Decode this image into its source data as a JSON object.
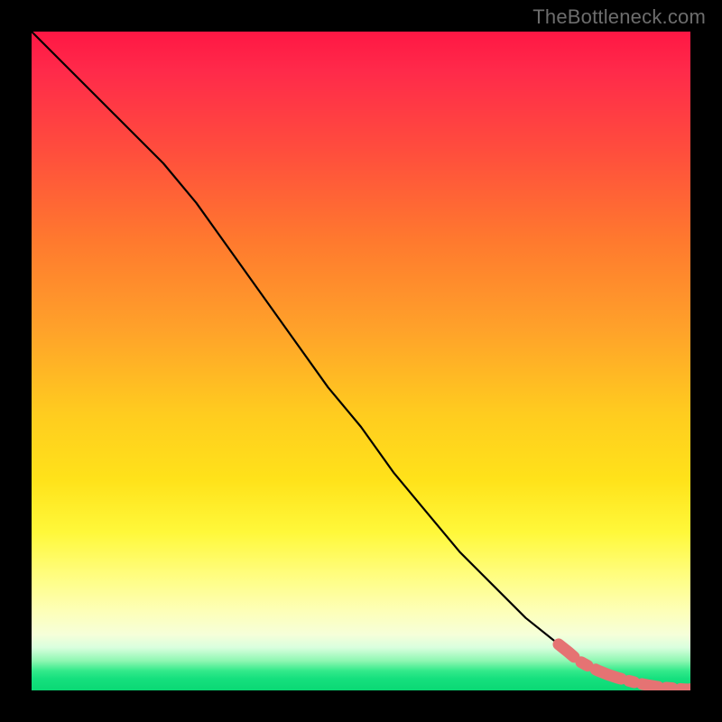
{
  "attribution": "TheBottleneck.com",
  "chart_data": {
    "type": "line",
    "title": "",
    "xlabel": "",
    "ylabel": "",
    "xlim": [
      0,
      100
    ],
    "ylim": [
      0,
      100
    ],
    "grid": false,
    "legend": false,
    "series": [
      {
        "name": "main-curve",
        "style": "solid",
        "color": "#000000",
        "x": [
          0,
          5,
          10,
          15,
          20,
          25,
          30,
          35,
          40,
          45,
          50,
          55,
          60,
          65,
          70,
          75,
          80,
          83,
          85,
          88,
          92,
          95,
          98,
          100
        ],
        "y": [
          100,
          95,
          90,
          85,
          80,
          74,
          67,
          60,
          53,
          46,
          40,
          33,
          27,
          21,
          16,
          11,
          7,
          4.5,
          3.2,
          2,
          1,
          0.5,
          0.2,
          0.1
        ]
      },
      {
        "name": "highlight-segment",
        "style": "dashed",
        "color": "#e57373",
        "x": [
          80,
          81.5,
          83,
          84.5,
          86,
          87.5,
          89,
          90.5,
          92,
          93.5,
          95,
          96.5,
          98,
          99,
          100
        ],
        "y": [
          7,
          5.8,
          4.5,
          3.7,
          3,
          2.4,
          1.9,
          1.5,
          1.1,
          0.8,
          0.55,
          0.4,
          0.25,
          0.18,
          0.12
        ]
      }
    ],
    "gradient_stops": [
      {
        "pos": 0.0,
        "color": "#ff1744"
      },
      {
        "pos": 0.32,
        "color": "#ff7a2e"
      },
      {
        "pos": 0.58,
        "color": "#ffcc1f"
      },
      {
        "pos": 0.82,
        "color": "#fffd7a"
      },
      {
        "pos": 0.955,
        "color": "#8ff7b2"
      },
      {
        "pos": 1.0,
        "color": "#0ad874"
      }
    ]
  },
  "plot_geometry": {
    "inner_left": 35,
    "inner_top": 35,
    "inner_width": 730,
    "inner_height": 730
  }
}
